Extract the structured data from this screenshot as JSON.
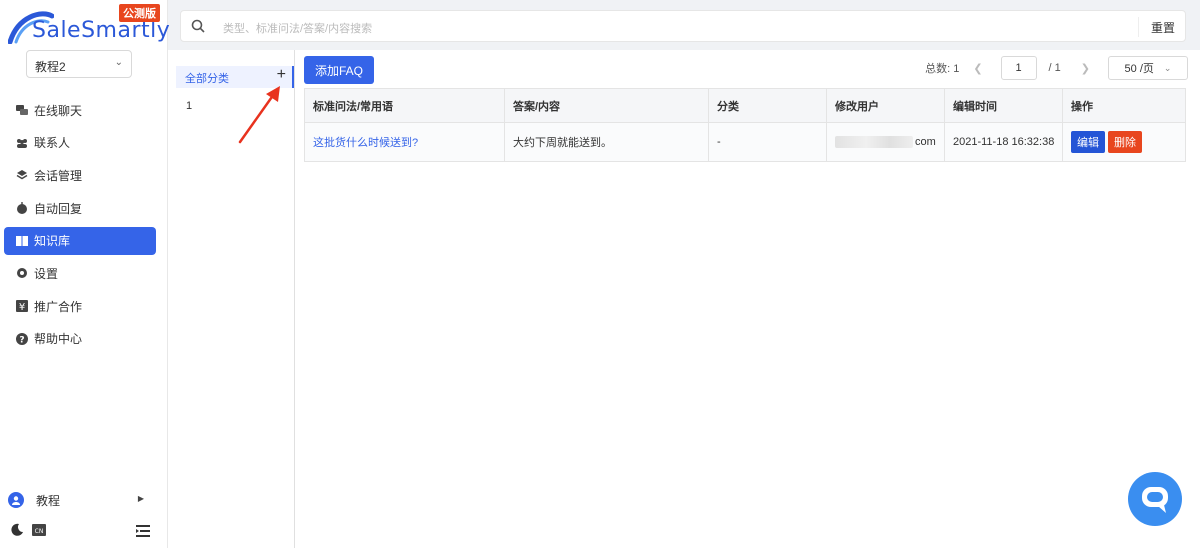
{
  "brand": {
    "name": "SaleSmartly",
    "badge": "公测版",
    "color": "#2b58d8"
  },
  "workspace": {
    "selected": "教程2"
  },
  "nav": [
    {
      "label": "在线聊天",
      "icon": "chat-icon"
    },
    {
      "label": "联系人",
      "icon": "contacts-icon"
    },
    {
      "label": "会话管理",
      "icon": "layers-icon"
    },
    {
      "label": "自动回复",
      "icon": "robot-icon"
    },
    {
      "label": "知识库",
      "icon": "book-icon",
      "active": true
    },
    {
      "label": "设置",
      "icon": "gear-icon"
    },
    {
      "label": "推广合作",
      "icon": "yen-icon"
    },
    {
      "label": "帮助中心",
      "icon": "help-icon"
    }
  ],
  "user": {
    "name": "教程"
  },
  "search": {
    "placeholder": "类型、标准问法/答案/内容搜索",
    "reset": "重置"
  },
  "categories": {
    "all": "全部分类",
    "items": [
      "1"
    ]
  },
  "toolbar": {
    "add_faq": "添加FAQ"
  },
  "pager": {
    "total_label": "总数:",
    "total": "1",
    "current": "1",
    "pages_text": "/  1",
    "page_size": "50 /页"
  },
  "table": {
    "headers": [
      "标准问法/常用语",
      "答案/内容",
      "分类",
      "修改用户",
      "编辑时间",
      "操作"
    ],
    "rows": [
      {
        "question": "这批货什么时候送到?",
        "answer": "大约下周就能送到。",
        "category": "-",
        "user_suffix": "com",
        "time": "2021-11-18 16:32:38",
        "edit": "编辑",
        "delete": "删除"
      }
    ]
  },
  "colors": {
    "accent": "#3564e8",
    "danger": "#e8461e",
    "annotation": "#e8321e"
  }
}
